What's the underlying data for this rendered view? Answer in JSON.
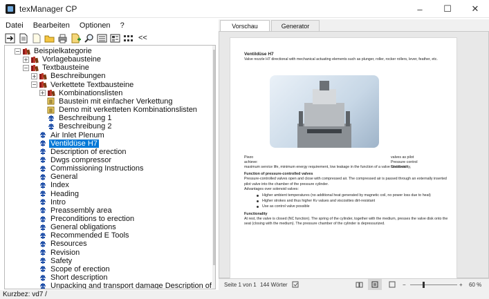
{
  "window": {
    "title": "texManager CP",
    "minimize": "–",
    "maximize": "☐",
    "close": "✕"
  },
  "menu": [
    "Datei",
    "Bearbeiten",
    "Optionen",
    "?"
  ],
  "toolbar": {
    "collapse_label": "<<"
  },
  "tree": {
    "items": [
      {
        "label": "Beispielkategorie",
        "level": 0,
        "icon": "books-icon",
        "expand": "−"
      },
      {
        "label": "Vorlagebausteine",
        "level": 1,
        "icon": "books-icon",
        "expand": "+"
      },
      {
        "label": "Textbausteine",
        "level": 1,
        "icon": "books-icon",
        "expand": "−"
      },
      {
        "label": "Beschreibungen",
        "level": 2,
        "icon": "books-icon",
        "expand": "+"
      },
      {
        "label": "Verkettete Textbausteine",
        "level": 2,
        "icon": "books-icon",
        "expand": "−"
      },
      {
        "label": "Kombinationslisten",
        "level": 3,
        "icon": "books-icon",
        "expand": "+"
      },
      {
        "label": "Baustein mit einfacher  Verkettung",
        "level": 3,
        "icon": "document-icon",
        "expand": ""
      },
      {
        "label": "Demo mit verketteten Kombinationslisten",
        "level": 3,
        "icon": "document-icon",
        "expand": ""
      },
      {
        "label": "Beschreibung 1",
        "level": 3,
        "icon": "valve-icon",
        "expand": ""
      },
      {
        "label": "Beschreibung 2",
        "level": 3,
        "icon": "valve-icon",
        "expand": ""
      },
      {
        "label": "Air Inlet Plenum",
        "level": 2,
        "icon": "valve-icon",
        "expand": ""
      },
      {
        "label": "Ventildüse H7",
        "level": 2,
        "icon": "valve-icon",
        "expand": "",
        "selected": true
      },
      {
        "label": "Description of erection",
        "level": 2,
        "icon": "valve-icon",
        "expand": ""
      },
      {
        "label": "Dwgs compressor",
        "level": 2,
        "icon": "valve-icon",
        "expand": ""
      },
      {
        "label": "Commissioning Instructions",
        "level": 2,
        "icon": "valve-icon",
        "expand": ""
      },
      {
        "label": "General",
        "level": 2,
        "icon": "valve-icon",
        "expand": ""
      },
      {
        "label": "Index",
        "level": 2,
        "icon": "valve-icon",
        "expand": ""
      },
      {
        "label": "Heading",
        "level": 2,
        "icon": "valve-icon",
        "expand": ""
      },
      {
        "label": "Intro",
        "level": 2,
        "icon": "valve-icon",
        "expand": ""
      },
      {
        "label": "Preassembly area",
        "level": 2,
        "icon": "valve-icon",
        "expand": ""
      },
      {
        "label": "Preconditions to erection",
        "level": 2,
        "icon": "valve-icon",
        "expand": ""
      },
      {
        "label": "General obligations",
        "level": 2,
        "icon": "valve-icon",
        "expand": ""
      },
      {
        "label": "Recommended E Tools",
        "level": 2,
        "icon": "valve-icon",
        "expand": ""
      },
      {
        "label": "Resources",
        "level": 2,
        "icon": "valve-icon",
        "expand": ""
      },
      {
        "label": "Revision",
        "level": 2,
        "icon": "valve-icon",
        "expand": ""
      },
      {
        "label": "Safety",
        "level": 2,
        "icon": "valve-icon",
        "expand": ""
      },
      {
        "label": "Scope of erection",
        "level": 2,
        "icon": "valve-icon",
        "expand": ""
      },
      {
        "label": "Short description",
        "level": 2,
        "icon": "valve-icon",
        "expand": ""
      },
      {
        "label": "Unpacking and transport damage Description of erection",
        "level": 2,
        "icon": "valve-icon",
        "expand": ""
      }
    ]
  },
  "status": "Kurzbez: vd7 /",
  "tabs": [
    {
      "label": "Vorschau",
      "active": true
    },
    {
      "label": "Generator",
      "active": false
    }
  ],
  "doc": {
    "title": "Ventildüse H7",
    "intro": "Valve nozzle H7 directional with mechanical actuating elements such as plunger, roller, rocker rollers, lever, feather, etc.",
    "piezo_left": "Piezo\nachieve:",
    "piezo_right": "valves as pilot\nPressure control\nfunctionality,",
    "para1": "maximum service life, minimum energy requirement, low leakage in the function of a valve Distributor.",
    "h_function": "Function of pressure-controlled valves",
    "para2": "Pressure-controlled valves open and close with compressed air. The compressed air is passed through an externally inserted pilot valve into the chamber of the pressure cylinder.",
    "para3": "Advantages over solenoid valves:",
    "bullets": [
      "Higher ambient temperatures (no additional heat generated by magnetic coil, no power loss due to heat)",
      "Higher strokes and thus higher Kv values and viscosities dirt-resistant",
      "Use as control valve possible"
    ],
    "h_functionality": "Functionality",
    "para4": "At rest, the valve is closed (NC function). The spring of the cylinder, together with the medium, presses the valve disk onto the seat (closing with the medium). The pressure chamber of the cylinder is depressurized."
  },
  "docstatus": {
    "page": "Seite 1 von 1",
    "words": "144 Wörter",
    "zoom_minus": "−",
    "zoom_plus": "+",
    "zoom": "60 %"
  }
}
